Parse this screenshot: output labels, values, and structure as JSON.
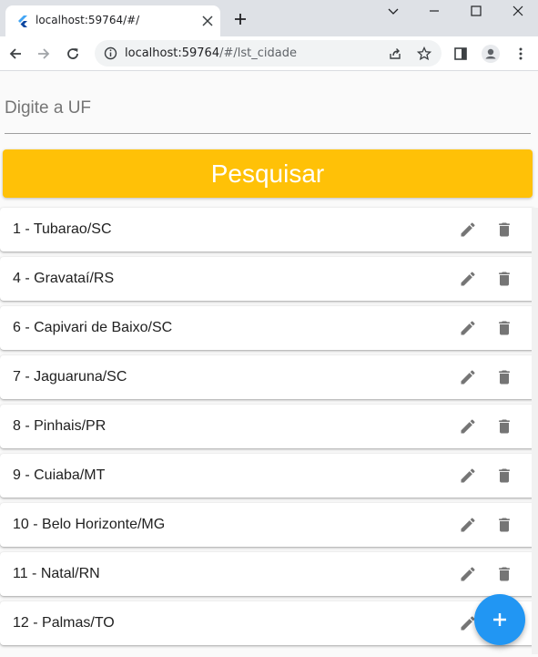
{
  "browser": {
    "tab_title": "localhost:59764/#/",
    "url_host": "localhost:59764",
    "url_path": "/#/lst_cidade"
  },
  "form": {
    "uf_placeholder": "Digite a UF",
    "search_button": "Pesquisar"
  },
  "cidades": [
    {
      "label": "1 - Tubarao/SC"
    },
    {
      "label": "4 - Gravataí/RS"
    },
    {
      "label": "6 - Capivari de Baixo/SC"
    },
    {
      "label": "7 - Jaguaruna/SC"
    },
    {
      "label": "8 - Pinhais/PR"
    },
    {
      "label": "9 - Cuiaba/MT"
    },
    {
      "label": "10 - Belo Horizonte/MG"
    },
    {
      "label": "11 - Natal/RN"
    },
    {
      "label": "12 - Palmas/TO"
    }
  ],
  "colors": {
    "search_button": "#ffc107",
    "fab": "#2196f3",
    "action_icon": "#757575"
  },
  "icons": {
    "edit": "pencil-icon",
    "delete": "trash-icon",
    "fab": "plus-icon"
  }
}
